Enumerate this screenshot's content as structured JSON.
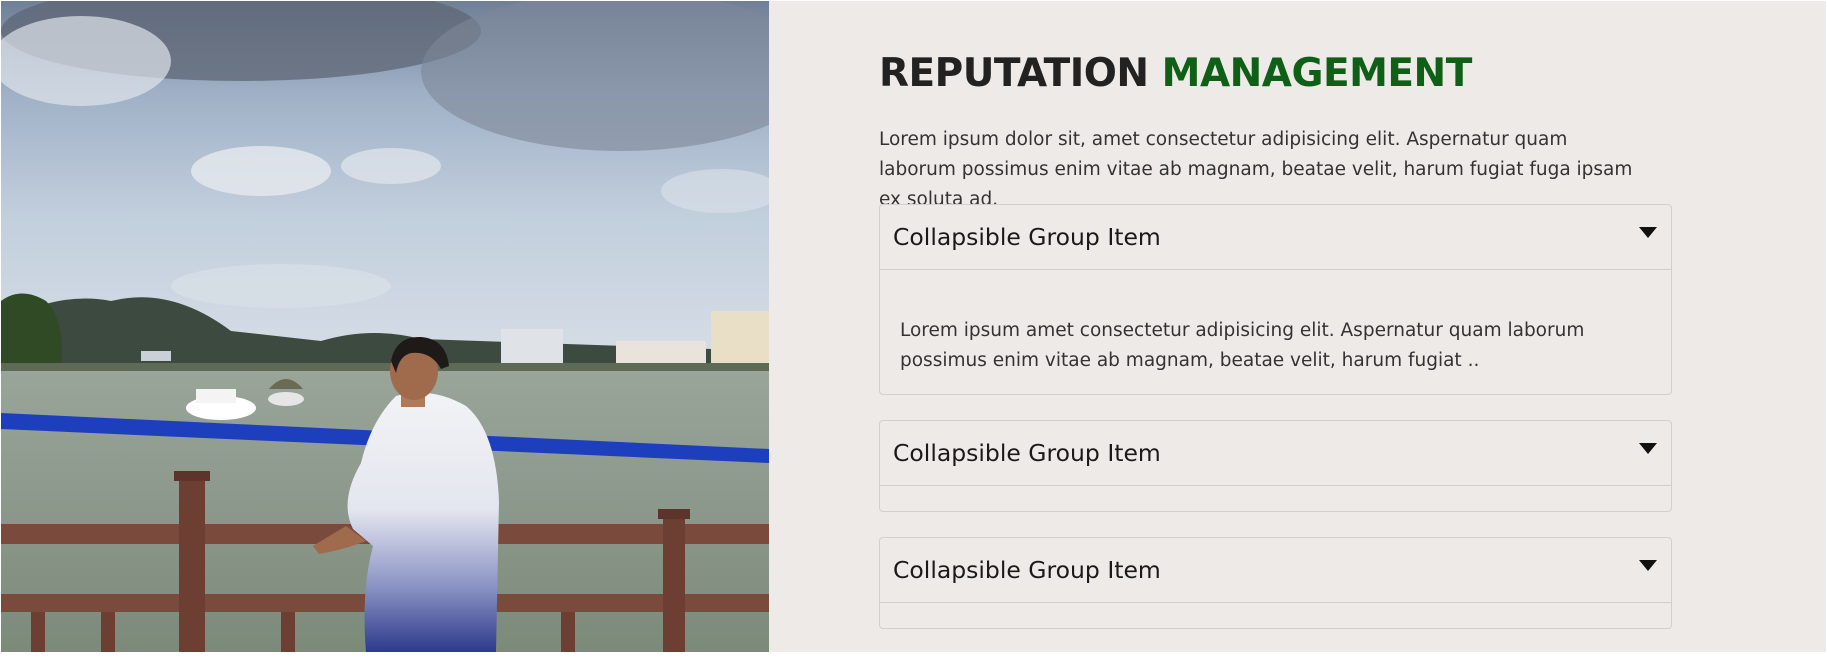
{
  "hero_image": {
    "icon": "photo-man-at-lake-railing"
  },
  "section": {
    "title_part1": "REPUTATION",
    "title_part2": "MANAGEMENT",
    "accent_color": "#0f6016",
    "intro": "Lorem ipsum dolor sit, amet consectetur adipisicing elit. Aspernatur quam laborum possimus enim vitae ab magnam, beatae velit, harum fugiat fuga ipsam ex soluta ad."
  },
  "accordion": {
    "items": [
      {
        "title": "Collapsible Group Item",
        "expanded": true,
        "body": "Lorem ipsum amet consectetur adipisicing elit. Aspernatur quam laborum possimus enim vitae ab magnam, beatae velit, harum fugiat .."
      },
      {
        "title": "Collapsible Group Item",
        "expanded": false
      },
      {
        "title": "Collapsible Group Item",
        "expanded": false
      }
    ]
  }
}
